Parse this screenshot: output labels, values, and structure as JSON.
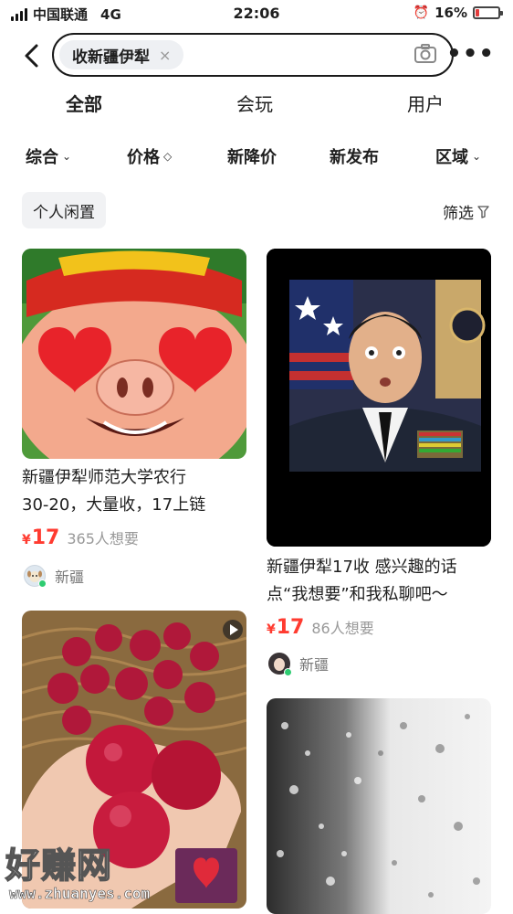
{
  "status_bar": {
    "carrier": "中国联通",
    "network": "4G",
    "time": "22:06",
    "battery": "16%",
    "battery_level": 0.16
  },
  "search": {
    "query": "收新疆伊犁",
    "clear_glyph": "×",
    "more_glyph": "•••"
  },
  "tabs": [
    {
      "label": "全部",
      "active": true
    },
    {
      "label": "会玩",
      "active": false
    },
    {
      "label": "用户",
      "active": false
    }
  ],
  "filters": [
    {
      "label": "综合",
      "caret": "⌄"
    },
    {
      "label": "价格",
      "caret": "◇"
    },
    {
      "label": "新降价",
      "caret": ""
    },
    {
      "label": "新发布",
      "caret": ""
    },
    {
      "label": "区域",
      "caret": "⌄"
    }
  ],
  "personal_chip": "个人闲置",
  "screen_label": "筛选",
  "listings": [
    {
      "title_line1": "新疆伊犁师范大学农行",
      "title_line2": "30-20，大量收，17上链",
      "currency": "¥",
      "price": "17",
      "want": "365人想要",
      "location": "新疆"
    },
    {
      "title_line1": "新疆伊犁17收 感兴趣的话",
      "title_line2": "点“我想要”和我私聊吧～",
      "currency": "¥",
      "price": "17",
      "want": "86人想要",
      "location": "新疆"
    }
  ],
  "watermark": {
    "text": "好赚网",
    "url": "www.zhuanyes.com"
  },
  "colors": {
    "accent_yellow": "#ffe600",
    "price_red": "#ff3b30",
    "online_green": "#2ecc71"
  }
}
